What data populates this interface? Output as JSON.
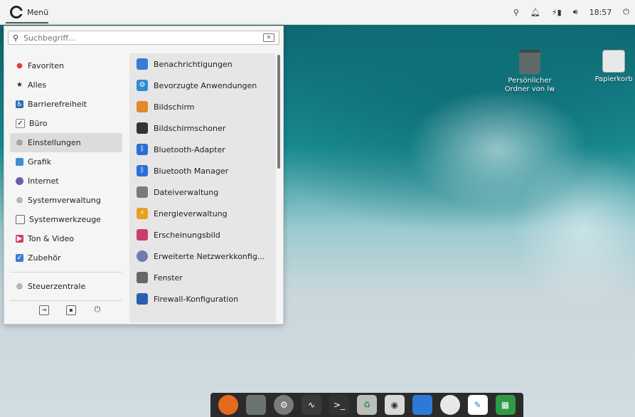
{
  "topbar": {
    "menu_label": "Menü",
    "clock": "18:57",
    "tray_icons": [
      "network-icon",
      "bell-icon",
      "battery-icon",
      "volume-icon",
      "power-icon"
    ]
  },
  "menu": {
    "search_placeholder": "Suchbegriff...",
    "categories": [
      {
        "label": "Favoriten",
        "icon": "heart-icon",
        "color": "#e23b3b"
      },
      {
        "label": "Alles",
        "icon": "star-icon",
        "color": "#222222"
      },
      {
        "label": "Barrierefreiheit",
        "icon": "accessibility-icon",
        "color": "#2a6fb0"
      },
      {
        "label": "Büro",
        "icon": "office-icon",
        "color": "#8a8a8a"
      },
      {
        "label": "Einstellungen",
        "icon": "settings-icon",
        "color": "#6e6e6e",
        "active": true
      },
      {
        "label": "Grafik",
        "icon": "graphics-icon",
        "color": "#3b8ed6"
      },
      {
        "label": "Internet",
        "icon": "globe-icon",
        "color": "#6b5ea8"
      },
      {
        "label": "Systemverwaltung",
        "icon": "system-icon",
        "color": "#6e6e6e"
      },
      {
        "label": "Systemwerkzeuge",
        "icon": "tools-icon",
        "color": "#6e6e6e"
      },
      {
        "label": "Ton & Video",
        "icon": "media-icon",
        "color": "#d23a6d"
      },
      {
        "label": "Zubehör",
        "icon": "accessories-icon",
        "color": "#3b7bd6"
      }
    ],
    "control_center": "Steuerzentrale",
    "apps": [
      {
        "label": "Benachrichtigungen",
        "icon": "notifications-icon",
        "color": "#3a7bd5"
      },
      {
        "label": "Bevorzugte Anwendungen",
        "icon": "preferred-apps-icon",
        "color": "#2e8bd0"
      },
      {
        "label": "Bildschirm",
        "icon": "display-icon",
        "color": "#e08a2c"
      },
      {
        "label": "Bildschirmschoner",
        "icon": "screensaver-icon",
        "color": "#333333"
      },
      {
        "label": "Bluetooth-Adapter",
        "icon": "bluetooth-icon",
        "color": "#2a6fd6"
      },
      {
        "label": "Bluetooth Manager",
        "icon": "bluetooth-icon",
        "color": "#2a6fd6"
      },
      {
        "label": "Dateiverwaltung",
        "icon": "file-manager-icon",
        "color": "#7a7a7a"
      },
      {
        "label": "Energieverwaltung",
        "icon": "energy-icon",
        "color": "#e7a11f"
      },
      {
        "label": "Erscheinungsbild",
        "icon": "appearance-icon",
        "color": "#cc3b6f"
      },
      {
        "label": "Erweiterte Netzwerkkonfig...",
        "icon": "network-config-icon",
        "color": "#6b7fa8"
      },
      {
        "label": "Fenster",
        "icon": "window-icon",
        "color": "#666666"
      },
      {
        "label": "Firewall-Konfiguration",
        "icon": "firewall-icon",
        "color": "#2a5fb0"
      }
    ]
  },
  "desktop": {
    "icons": [
      {
        "label": "Persönlicher Ordner von lw",
        "icon": "home-folder-icon"
      },
      {
        "label": "Papierkorb",
        "icon": "trash-icon"
      }
    ]
  },
  "dock": {
    "items": [
      {
        "name": "firefox-icon",
        "color": "#e56a1c"
      },
      {
        "name": "files-icon",
        "color": "#6a7470"
      },
      {
        "name": "settings-icon",
        "color": "#7b7b7b"
      },
      {
        "name": "system-monitor-icon",
        "color": "#3a3a3a"
      },
      {
        "name": "terminal-icon",
        "color": "#333333"
      },
      {
        "name": "trash-icon",
        "color": "#bdbdbd"
      },
      {
        "name": "disk-icon",
        "color": "#d9d9d9"
      },
      {
        "name": "screenshot-icon",
        "color": "#2b7bd6"
      },
      {
        "name": "chat-icon",
        "color": "#e8e8e8"
      },
      {
        "name": "text-editor-icon",
        "color": "#ffffff"
      },
      {
        "name": "spreadsheet-icon",
        "color": "#2f9a45"
      }
    ]
  }
}
